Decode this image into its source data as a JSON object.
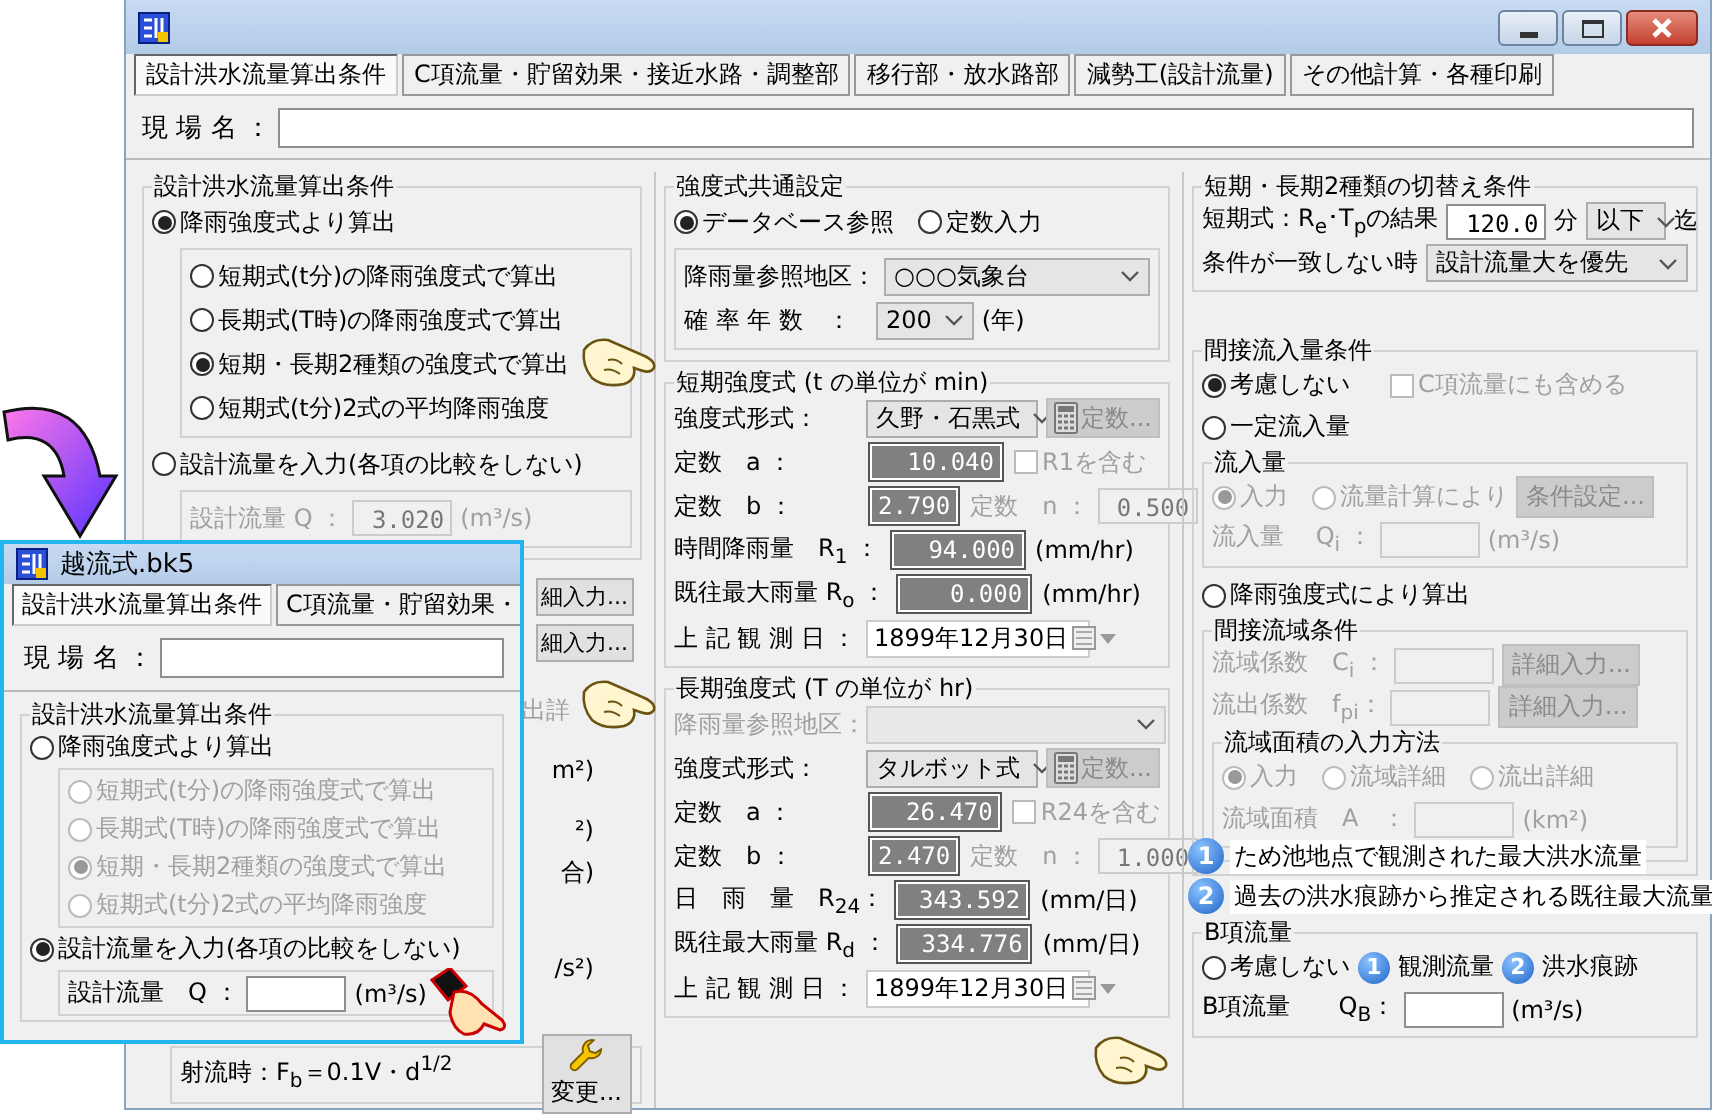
{
  "main_window": {
    "tabs": [
      {
        "label": "設計洪水流量算出条件",
        "selected": true
      },
      {
        "label": "C項流量・貯留効果・接近水路・調整部",
        "selected": false
      },
      {
        "label": "移行部・放水路部",
        "selected": false
      },
      {
        "label": "減勢工(設計流量)",
        "selected": false
      },
      {
        "label": "その他計算・各種印刷",
        "selected": false
      }
    ],
    "site_label": "現 場 名 ：",
    "columns": [
      {
        "sections": [
          {
            "kind": "group",
            "title": "設計洪水流量算出条件",
            "rows": [
              {
                "kind": "row",
                "items": [
                  {
                    "kind": "radio",
                    "label": "降雨強度式より算出",
                    "selected": true
                  }
                ]
              },
              {
                "kind": "group",
                "rows": [
                  {
                    "kind": "row",
                    "items": [
                      {
                        "kind": "radio",
                        "label": "短期式(t分)の降雨強度式で算出",
                        "selected": false
                      }
                    ]
                  },
                  {
                    "kind": "row",
                    "items": [
                      {
                        "kind": "radio",
                        "label": "長期式(T時)の降雨強度式で算出",
                        "selected": false
                      }
                    ]
                  },
                  {
                    "kind": "row",
                    "items": [
                      {
                        "kind": "radio",
                        "label": "短期・長期2種類の強度式で算出",
                        "selected": true
                      }
                    ]
                  },
                  {
                    "kind": "row",
                    "items": [
                      {
                        "kind": "radio",
                        "label": "短期式(t分)2式の平均降雨強度",
                        "selected": false
                      }
                    ]
                  }
                ]
              },
              {
                "kind": "row",
                "items": [
                  {
                    "kind": "radio",
                    "label": "設計流量を入力(各項の比較をしない)",
                    "selected": false
                  }
                ]
              },
              {
                "kind": "group",
                "rows": [
                  {
                    "kind": "row",
                    "items": [
                      {
                        "kind": "label",
                        "text": "設計流量 Q ：",
                        "disabled": true
                      },
                      {
                        "kind": "field",
                        "value": "3.020",
                        "disabled": true
                      },
                      {
                        "kind": "label",
                        "text": "(m³/s)",
                        "disabled": true
                      }
                    ]
                  }
                ]
              }
            ]
          },
          {
            "kind": "fragments",
            "items": [
              {
                "kind": "button",
                "label": "細入力..."
              },
              {
                "kind": "button",
                "label": "細入力..."
              },
              {
                "kind": "label",
                "text": "出詳",
                "disabled": true
              },
              {
                "kind": "label",
                "text": "m²)",
                "disabled": false
              },
              {
                "kind": "label",
                "text": "²)",
                "disabled": false
              },
              {
                "kind": "label",
                "text": "合)",
                "disabled": false
              },
              {
                "kind": "label",
                "text": "/s²)",
                "disabled": false
              }
            ]
          },
          {
            "kind": "group",
            "rows": [
              {
                "kind": "row",
                "items": [
                  {
                    "kind": "label",
                    "text": "射流時：F$_{b}$＝0.1V・d$^{1/2}$"
                  },
                  {
                    "kind": "tool-button",
                    "label": "変更..."
                  }
                ]
              }
            ]
          }
        ]
      },
      {
        "sections": [
          {
            "kind": "group",
            "title": "強度式共通設定",
            "rows": [
              {
                "kind": "row",
                "items": [
                  {
                    "kind": "radio",
                    "label": "データベース参照",
                    "selected": true
                  },
                  {
                    "kind": "radio",
                    "label": "定数入力",
                    "selected": false
                  }
                ]
              },
              {
                "kind": "group",
                "rows": [
                  {
                    "kind": "row",
                    "items": [
                      {
                        "kind": "label",
                        "text": "降雨量参照地区："
                      },
                      {
                        "kind": "select",
                        "value": "○○○気象台"
                      }
                    ]
                  },
                  {
                    "kind": "row",
                    "items": [
                      {
                        "kind": "label",
                        "text": "確 率 年 数　："
                      },
                      {
                        "kind": "select",
                        "value": "200"
                      },
                      {
                        "kind": "label",
                        "text": "(年)"
                      }
                    ]
                  }
                ]
              }
            ]
          },
          {
            "kind": "group",
            "title": "短期強度式 (t の単位が min)",
            "rows": [
              {
                "kind": "row",
                "items": [
                  {
                    "kind": "label",
                    "text": "強度式形式："
                  },
                  {
                    "kind": "select",
                    "value": "久野・石黒式"
                  },
                  {
                    "kind": "calc-button",
                    "label": "定数...",
                    "disabled": true
                  }
                ]
              },
              {
                "kind": "row",
                "items": [
                  {
                    "kind": "label",
                    "text": "定数　a ："
                  },
                  {
                    "kind": "readout",
                    "value": "10.040"
                  },
                  {
                    "kind": "checkbox",
                    "label": "R1を含む",
                    "checked": false,
                    "disabled": true
                  }
                ]
              },
              {
                "kind": "row",
                "items": [
                  {
                    "kind": "label",
                    "text": "定数　b ："
                  },
                  {
                    "kind": "readout",
                    "value": "2.790"
                  },
                  {
                    "kind": "label",
                    "text": "定数　n ：",
                    "disabled": true
                  },
                  {
                    "kind": "field",
                    "value": "0.500",
                    "disabled": true
                  }
                ]
              },
              {
                "kind": "row",
                "items": [
                  {
                    "kind": "label",
                    "text": "時間降雨量　R$_{1}$ ："
                  },
                  {
                    "kind": "readout",
                    "value": "94.000"
                  },
                  {
                    "kind": "label",
                    "text": "(mm/hr)"
                  }
                ]
              },
              {
                "kind": "row",
                "items": [
                  {
                    "kind": "label",
                    "text": "既往最大雨量 R$_{o}$ ："
                  },
                  {
                    "kind": "readout",
                    "value": "0.000"
                  },
                  {
                    "kind": "label",
                    "text": "(mm/hr)"
                  }
                ]
              },
              {
                "kind": "row",
                "items": [
                  {
                    "kind": "label",
                    "text": "上 記 観 測 日 ："
                  },
                  {
                    "kind": "date",
                    "value": "1899年12月30日"
                  }
                ]
              }
            ]
          },
          {
            "kind": "group",
            "title": "長期強度式 (T の単位が hr)",
            "rows": [
              {
                "kind": "row",
                "items": [
                  {
                    "kind": "label",
                    "text": "降雨量参照地区：",
                    "disabled": true
                  },
                  {
                    "kind": "select",
                    "disabled": true
                  }
                ]
              },
              {
                "kind": "row",
                "items": [
                  {
                    "kind": "label",
                    "text": "強度式形式："
                  },
                  {
                    "kind": "select",
                    "value": "タルボット式"
                  },
                  {
                    "kind": "calc-button",
                    "label": "定数...",
                    "disabled": true
                  }
                ]
              },
              {
                "kind": "row",
                "items": [
                  {
                    "kind": "label",
                    "text": "定数　a ："
                  },
                  {
                    "kind": "readout",
                    "value": "26.470"
                  },
                  {
                    "kind": "checkbox",
                    "label": "R24を含む",
                    "checked": false,
                    "disabled": true
                  }
                ]
              },
              {
                "kind": "row",
                "items": [
                  {
                    "kind": "label",
                    "text": "定数　b ："
                  },
                  {
                    "kind": "readout",
                    "value": "2.470"
                  },
                  {
                    "kind": "label",
                    "text": "定数　n ：",
                    "disabled": true
                  },
                  {
                    "kind": "field",
                    "value": "1.000",
                    "disabled": true
                  }
                ]
              },
              {
                "kind": "row",
                "items": [
                  {
                    "kind": "label",
                    "text": "日　雨　量　R$_{24}$："
                  },
                  {
                    "kind": "readout",
                    "value": "343.592"
                  },
                  {
                    "kind": "label",
                    "text": "(mm/日)"
                  }
                ]
              },
              {
                "kind": "row",
                "items": [
                  {
                    "kind": "label",
                    "text": "既往最大雨量 R$_{d}$ ："
                  },
                  {
                    "kind": "readout",
                    "value": "334.776"
                  },
                  {
                    "kind": "label",
                    "text": "(mm/日)"
                  }
                ]
              },
              {
                "kind": "row",
                "items": [
                  {
                    "kind": "label",
                    "text": "上 記 観 測 日 ："
                  },
                  {
                    "kind": "date",
                    "value": "1899年12月30日"
                  }
                ]
              }
            ]
          }
        ]
      },
      {
        "sections": [
          {
            "kind": "group",
            "title": "短期・長期2種類の切替え条件",
            "rows": [
              {
                "kind": "row",
                "items": [
                  {
                    "kind": "label",
                    "text": "短期式：R$_{e}$･T$_{p}$の結果"
                  },
                  {
                    "kind": "field",
                    "value": "120.0"
                  },
                  {
                    "kind": "label",
                    "text": "分"
                  },
                  {
                    "kind": "select",
                    "value": "以下"
                  },
                  {
                    "kind": "label",
                    "text": "迄"
                  }
                ]
              },
              {
                "kind": "row",
                "items": [
                  {
                    "kind": "label",
                    "text": "条件が一致しない時"
                  },
                  {
                    "kind": "select",
                    "value": "設計流量大を優先"
                  }
                ]
              }
            ]
          },
          {
            "kind": "group",
            "title": "間接流入量条件",
            "rows": [
              {
                "kind": "row",
                "items": [
                  {
                    "kind": "radio",
                    "label": "考慮しない",
                    "selected": true
                  },
                  {
                    "kind": "checkbox",
                    "label": "C項流量にも含める",
                    "checked": false,
                    "disabled": true
                  }
                ]
              },
              {
                "kind": "row",
                "items": [
                  {
                    "kind": "radio",
                    "label": "一定流入量",
                    "selected": false
                  }
                ]
              },
              {
                "kind": "group",
                "title": "流入量",
                "rows": [
                  {
                    "kind": "row",
                    "items": [
                      {
                        "kind": "radio",
                        "label": "入力",
                        "selected": true,
                        "disabled": true
                      },
                      {
                        "kind": "radio",
                        "label": "流量計算により",
                        "selected": false,
                        "disabled": true
                      },
                      {
                        "kind": "button",
                        "label": "条件設定...",
                        "disabled": true
                      }
                    ]
                  },
                  {
                    "kind": "row",
                    "items": [
                      {
                        "kind": "label",
                        "text": "流入量　 Q$_{i}$ ：",
                        "disabled": true
                      },
                      {
                        "kind": "field",
                        "disabled": true
                      },
                      {
                        "kind": "label",
                        "text": "(m³/s)",
                        "disabled": true
                      }
                    ]
                  }
                ]
              },
              {
                "kind": "row",
                "items": [
                  {
                    "kind": "radio",
                    "label": "降雨強度式により算出",
                    "selected": false
                  }
                ]
              },
              {
                "kind": "group",
                "title": "間接流域条件",
                "rows": [
                  {
                    "kind": "row",
                    "items": [
                      {
                        "kind": "label",
                        "text": "流域係数　C$_{i}$ ：",
                        "disabled": true
                      },
                      {
                        "kind": "field",
                        "disabled": true
                      },
                      {
                        "kind": "button",
                        "label": "詳細入力...",
                        "disabled": true
                      }
                    ]
                  },
                  {
                    "kind": "row",
                    "items": [
                      {
                        "kind": "label",
                        "text": "流出係数　f$_{pi}$：",
                        "disabled": true
                      },
                      {
                        "kind": "field",
                        "disabled": true
                      },
                      {
                        "kind": "button",
                        "label": "詳細入力...",
                        "disabled": true
                      }
                    ]
                  },
                  {
                    "kind": "group",
                    "title": "流域面積の入力方法",
                    "rows": [
                      {
                        "kind": "row",
                        "items": [
                          {
                            "kind": "radio",
                            "label": "入力",
                            "selected": true,
                            "disabled": true
                          },
                          {
                            "kind": "radio",
                            "label": "流域詳細",
                            "selected": false,
                            "disabled": true
                          },
                          {
                            "kind": "radio",
                            "label": "流出詳細",
                            "selected": false,
                            "disabled": true
                          }
                        ]
                      },
                      {
                        "kind": "row",
                        "items": [
                          {
                            "kind": "label",
                            "text": "流域面積　A　：",
                            "disabled": true
                          },
                          {
                            "kind": "field",
                            "disabled": true
                          },
                          {
                            "kind": "label",
                            "text": "(km²)",
                            "disabled": true
                          }
                        ]
                      }
                    ]
                  }
                ]
              }
            ]
          },
          {
            "kind": "notes",
            "items": [
              {
                "badge": "1",
                "text": "ため池地点で観測された最大洪水流量"
              },
              {
                "badge": "2",
                "text": "過去の洪水痕跡から推定される既往最大流量"
              }
            ]
          },
          {
            "kind": "group",
            "title": "B項流量",
            "rows": [
              {
                "kind": "row",
                "items": [
                  {
                    "kind": "radio",
                    "label": "考慮しない",
                    "selected": false
                  },
                  {
                    "kind": "badge",
                    "text": "1"
                  },
                  {
                    "kind": "label",
                    "text": "観測流量"
                  },
                  {
                    "kind": "badge",
                    "text": "2"
                  },
                  {
                    "kind": "label",
                    "text": "洪水痕跡"
                  }
                ]
              },
              {
                "kind": "row",
                "items": [
                  {
                    "kind": "label",
                    "text": "B項流量　　Q$_{B}$："
                  },
                  {
                    "kind": "field"
                  },
                  {
                    "kind": "label",
                    "text": "(m³/s)"
                  }
                ]
              }
            ]
          }
        ]
      }
    ]
  },
  "inset_window": {
    "title": "越流式.bk5",
    "tabs": [
      {
        "label": "設計洪水流量算出条件",
        "selected": true
      },
      {
        "label": "C項流量・貯留効果・",
        "selected": false
      }
    ],
    "site_label": "現 場 名 ：",
    "sections": [
      {
        "kind": "group",
        "title": "設計洪水流量算出条件",
        "rows": [
          {
            "kind": "row",
            "items": [
              {
                "kind": "radio",
                "label": "降雨強度式より算出",
                "selected": false
              }
            ]
          },
          {
            "kind": "group",
            "rows": [
              {
                "kind": "row",
                "items": [
                  {
                    "kind": "radio",
                    "label": "短期式(t分)の降雨強度式で算出",
                    "selected": false,
                    "disabled": true
                  }
                ]
              },
              {
                "kind": "row",
                "items": [
                  {
                    "kind": "radio",
                    "label": "長期式(T時)の降雨強度式で算出",
                    "selected": false,
                    "disabled": true
                  }
                ]
              },
              {
                "kind": "row",
                "items": [
                  {
                    "kind": "radio",
                    "label": "短期・長期2種類の強度式で算出",
                    "selected": true,
                    "disabled": true
                  }
                ]
              },
              {
                "kind": "row",
                "items": [
                  {
                    "kind": "radio",
                    "label": "短期式(t分)2式の平均降雨強度",
                    "selected": false,
                    "disabled": true
                  }
                ]
              }
            ]
          },
          {
            "kind": "row",
            "items": [
              {
                "kind": "radio",
                "label": "設計流量を入力(各項の比較をしない)",
                "selected": true
              }
            ]
          },
          {
            "kind": "group",
            "rows": [
              {
                "kind": "row",
                "items": [
                  {
                    "kind": "label",
                    "text": "設計流量　Q ："
                  },
                  {
                    "kind": "field"
                  },
                  {
                    "kind": "label",
                    "text": "(m³/s)"
                  }
                ]
              }
            ]
          }
        ]
      }
    ]
  }
}
